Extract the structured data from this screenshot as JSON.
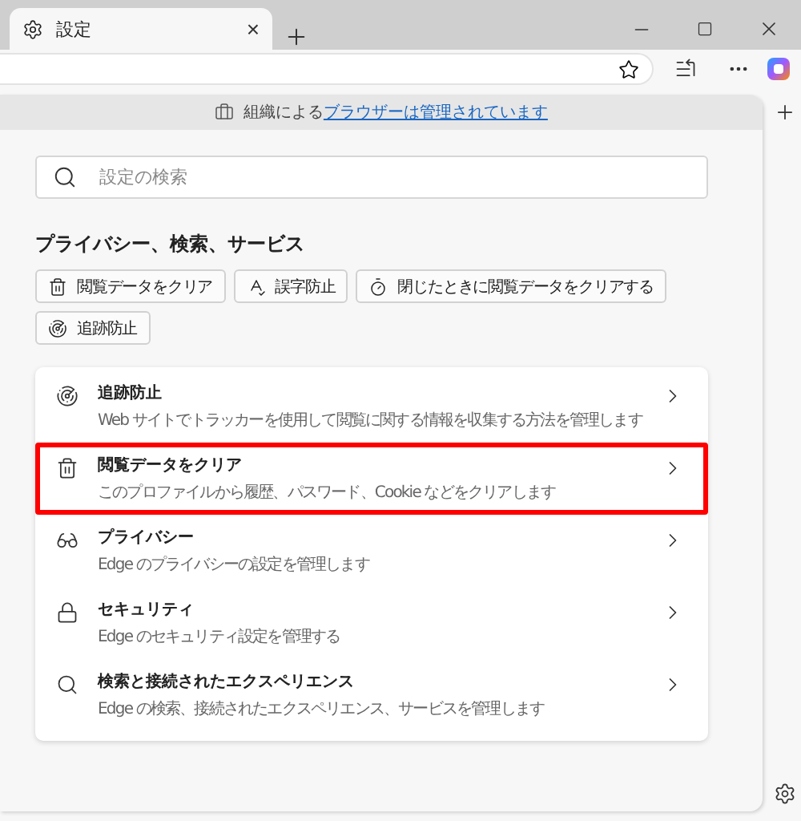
{
  "tab": {
    "title": "設定",
    "close": "×"
  },
  "managed_banner": {
    "text": "組織による",
    "link": "ブラウザーは管理されています"
  },
  "search": {
    "placeholder": "設定の検索"
  },
  "section_title": "プライバシー、検索、サービス",
  "chips": [
    "閲覧データをクリア",
    "誤字防止",
    "閉じたときに閲覧データをクリアする",
    "追跡防止"
  ],
  "items": [
    {
      "title": "追跡防止",
      "description": "Web サイトでトラッカーを使用して閲覧に関する情報を収集する方法を管理します",
      "highlighted": false
    },
    {
      "title": "閲覧データをクリア",
      "description": "このプロファイルから履歴、パスワード、Cookie などをクリアします",
      "highlighted": true
    },
    {
      "title": "プライバシー",
      "description": "Edge のプライバシーの設定を管理します",
      "highlighted": false
    },
    {
      "title": "セキュリティ",
      "description": "Edge のセキュリティ設定を管理する",
      "highlighted": false
    },
    {
      "title": "検索と接続されたエクスペリエンス",
      "description": "Edge の検索、接続されたエクスペリエンス、サービスを管理します",
      "highlighted": false
    }
  ]
}
